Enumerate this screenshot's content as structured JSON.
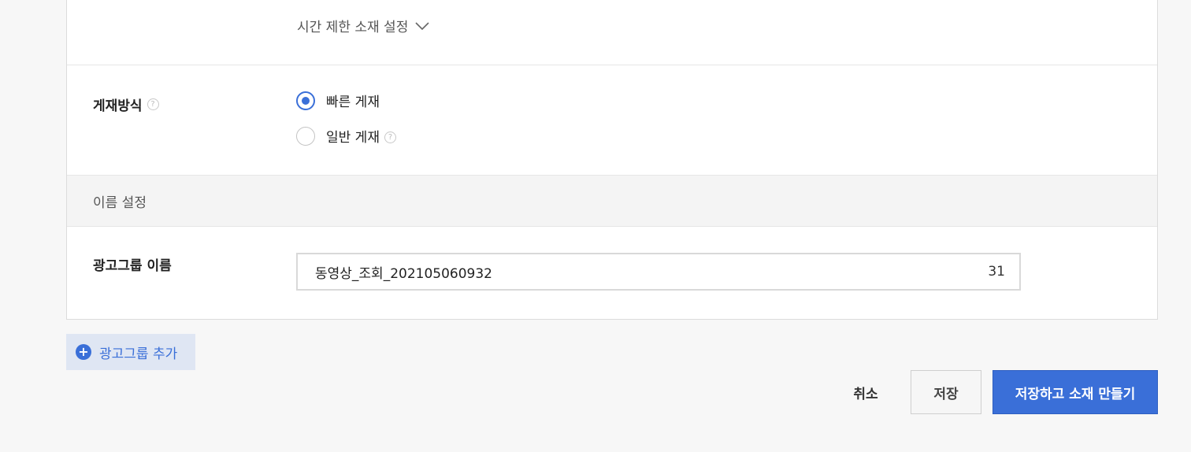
{
  "time_limit": {
    "label": "시간 제한 소재 설정",
    "icon": "chevron-down-icon"
  },
  "method": {
    "label": "게재방식",
    "help_icon": "?",
    "options": [
      {
        "label": "빠른 게재",
        "selected": true
      },
      {
        "label": "일반 게재",
        "selected": false,
        "help_icon": "?"
      }
    ]
  },
  "name_section": {
    "title": "이름 설정"
  },
  "ad_group_name": {
    "label": "광고그룹 이름",
    "value": "동영상_조회_202105060932",
    "counter": "31"
  },
  "add_group": {
    "icon": "+",
    "label": "광고그룹 추가"
  },
  "actions": {
    "cancel": "취소",
    "save": "저장",
    "save_and_create": "저장하고 소재 만들기"
  },
  "colors": {
    "accent": "#3a6fd8",
    "accent_light": "#dfe6f3"
  }
}
